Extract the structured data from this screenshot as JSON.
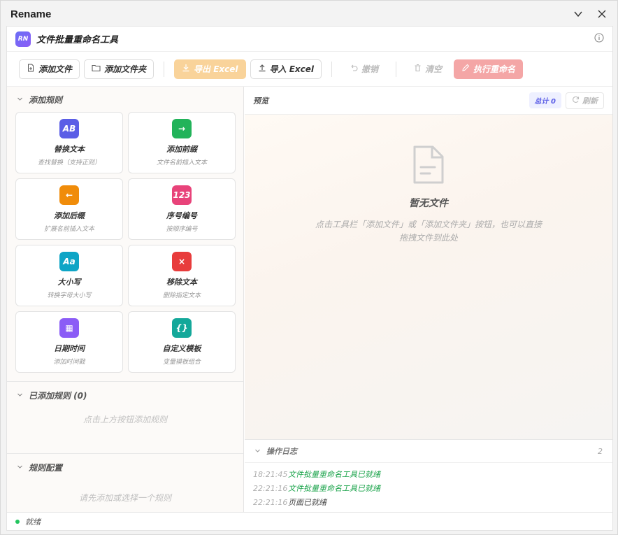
{
  "window": {
    "title": "Rename"
  },
  "app": {
    "logo_text": "RN",
    "title": "文件批量重命名工具"
  },
  "toolbar": {
    "add_file": "添加文件",
    "add_folder": "添加文件夹",
    "export_excel": "导出 Excel",
    "import_excel": "导入 Excel",
    "undo": "撤销",
    "clear": "清空",
    "execute": "执行重命名"
  },
  "rules_panel": {
    "title": "添加规则",
    "cards": [
      {
        "icon_text": "AB",
        "icon_color": "#5b5ee6",
        "title": "替换文本",
        "desc": "查找替换（支持正则）"
      },
      {
        "icon_text": "→",
        "icon_color": "#22b35a",
        "title": "添加前缀",
        "desc": "文件名前插入文本"
      },
      {
        "icon_text": "←",
        "icon_color": "#f08c0a",
        "title": "添加后缀",
        "desc": "扩展名前插入文本"
      },
      {
        "icon_text": "123",
        "icon_color": "#e8437a",
        "title": "序号编号",
        "desc": "按顺序编号"
      },
      {
        "icon_text": "Aa",
        "icon_color": "#0ea5c6",
        "title": "大小写",
        "desc": "转换字母大小写"
      },
      {
        "icon_text": "×",
        "icon_color": "#e83c3c",
        "title": "移除文本",
        "desc": "删除指定文本"
      },
      {
        "icon_text": "▦",
        "icon_color": "#8b5cf6",
        "title": "日期时间",
        "desc": "添加时间戳"
      },
      {
        "icon_text": "{}",
        "icon_color": "#14a89a",
        "title": "自定义模板",
        "desc": "变量模板组合"
      }
    ]
  },
  "added_rules": {
    "title": "已添加规则 (0)",
    "empty": "点击上方按钮添加规则"
  },
  "rule_config": {
    "title": "规则配置",
    "empty": "请先添加或选择一个规则"
  },
  "preview": {
    "title": "预览",
    "total": "总计 0",
    "refresh": "刷新",
    "empty_title": "暂无文件",
    "empty_desc": "点击工具栏「添加文件」或「添加文件夹」按钮，也可以直接拖拽文件到此处"
  },
  "log": {
    "title": "操作日志",
    "count": "2",
    "entries": [
      {
        "time": "18:21:45",
        "msg": "文件批量重命名工具已就绪",
        "color": "#1aa34a"
      },
      {
        "time": "22:21:16",
        "msg": "文件批量重命名工具已就绪",
        "color": "#1aa34a"
      },
      {
        "time": "22:21:16",
        "msg": "页面已就绪",
        "color": "#444444"
      }
    ]
  },
  "status": {
    "text": "就绪",
    "color": "#22c55e"
  }
}
